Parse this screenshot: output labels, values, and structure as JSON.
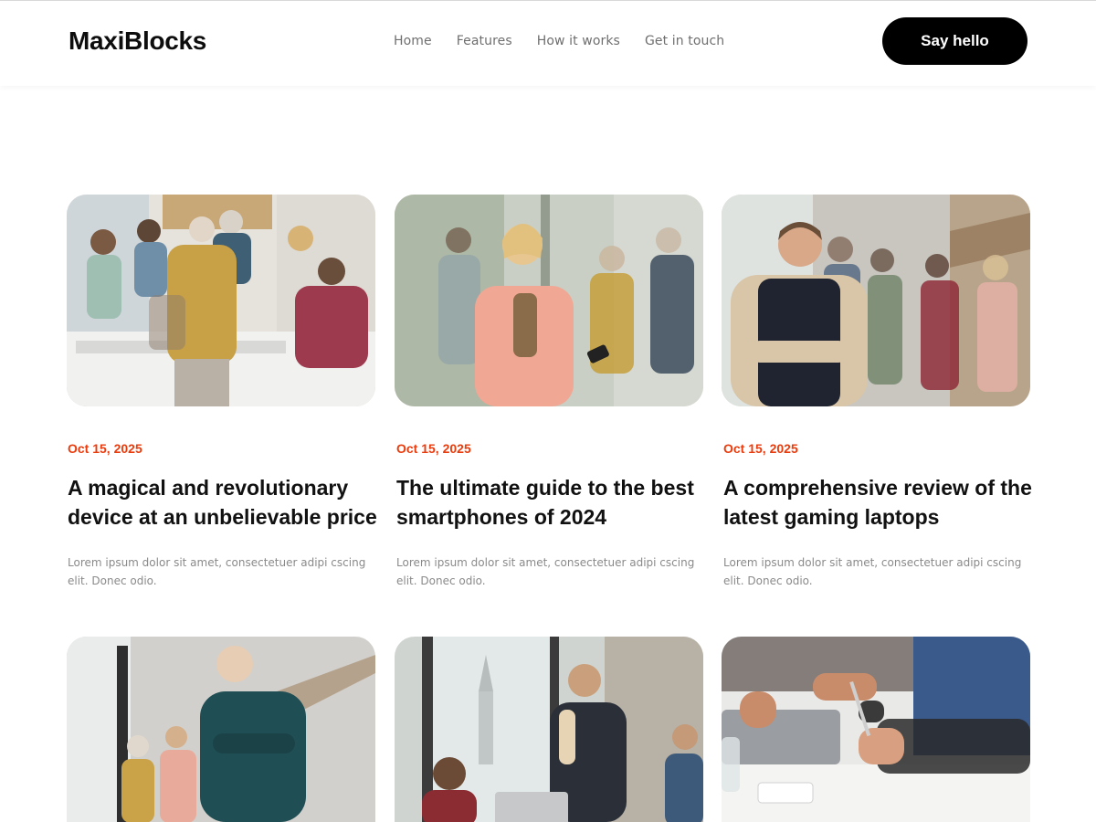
{
  "header": {
    "logo": "MaxiBlocks",
    "nav": [
      "Home",
      "Features",
      "How it works",
      "Get in touch"
    ],
    "cta_label": "Say hello"
  },
  "posts": [
    {
      "date": "Oct 15, 2025",
      "title": "A magical and revolutionary device at an unbelievable price",
      "excerpt": "Lorem ipsum dolor sit amet, consectetuer adipi cscing elit. Donec odio.",
      "image": "office-team-meeting-photo"
    },
    {
      "date": "Oct 15, 2025",
      "title": "The ultimate guide to the best smartphones of 2024",
      "excerpt": "Lorem ipsum dolor sit amet, consectetuer adipi cscing elit. Donec odio.",
      "image": "woman-using-smartphone-photo"
    },
    {
      "date": "Oct 15, 2025",
      "title": "A comprehensive review of the latest gaming laptops",
      "excerpt": "Lorem ipsum dolor sit amet, consectetuer adipi cscing elit. Donec odio.",
      "image": "smiling-man-arms-crossed-photo"
    },
    {
      "image": "senior-man-office-photo"
    },
    {
      "image": "presentation-meeting-photo"
    },
    {
      "image": "signing-document-photo"
    }
  ],
  "colors": {
    "accent": "#ea3b0c",
    "cta_background": "#000000",
    "nav_text": "#6f6f6f",
    "excerpt_text": "#8a8a8a"
  }
}
